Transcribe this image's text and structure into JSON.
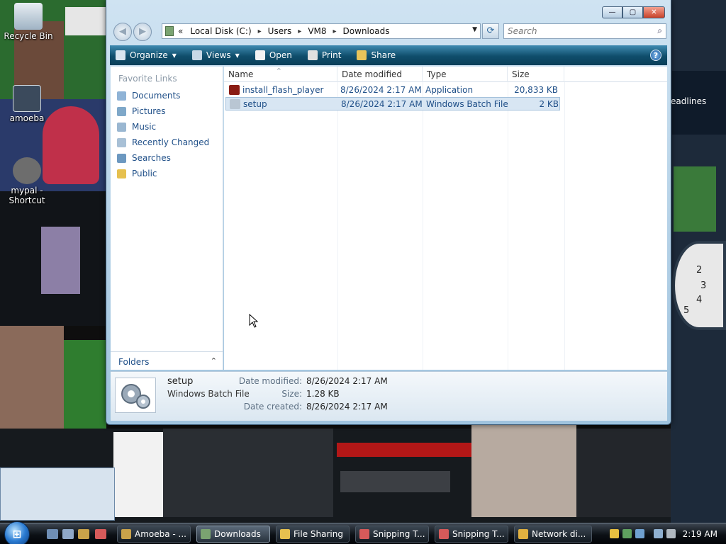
{
  "desktop": {
    "icons": [
      {
        "label": "Recycle Bin"
      },
      {
        "label": "amoeba"
      },
      {
        "label": "mypal - Shortcut"
      }
    ],
    "gadget_text": "eadlines",
    "clock_numbers": [
      "2",
      "3",
      "4",
      "5"
    ]
  },
  "window": {
    "caption": {
      "minimize": "—",
      "maximize": "▢",
      "close": "✕"
    },
    "nav": {
      "back": "◀",
      "forward": "▶"
    },
    "address": {
      "crumbs": [
        "Local Disk (C:)",
        "Users",
        "VM8",
        "Downloads"
      ],
      "separator": "▸",
      "lead": "«",
      "dropdown": "▼"
    },
    "refresh": "⟳",
    "search": {
      "placeholder": "Search",
      "icon": "⌕"
    },
    "commands": [
      {
        "label": "Organize",
        "icon": "organize-icon",
        "color": "#d9e6f0",
        "dropdown": true
      },
      {
        "label": "Views",
        "icon": "views-icon",
        "color": "#c7d7e6",
        "dropdown": true
      },
      {
        "label": "Open",
        "icon": "open-icon",
        "color": "#f3f3f3",
        "dropdown": false
      },
      {
        "label": "Print",
        "icon": "print-icon",
        "color": "#e0e0e0",
        "dropdown": false
      },
      {
        "label": "Share",
        "icon": "share-icon",
        "color": "#e8c45a",
        "dropdown": false
      }
    ],
    "help": "?",
    "favorite_links_title": "Favorite Links",
    "favorite_links": [
      {
        "label": "Documents",
        "color": "#8fb3d6"
      },
      {
        "label": "Pictures",
        "color": "#7fa8c9"
      },
      {
        "label": "Music",
        "color": "#9ab7d1"
      },
      {
        "label": "Recently Changed",
        "color": "#a8c0d6"
      },
      {
        "label": "Searches",
        "color": "#6c98c0"
      },
      {
        "label": "Public",
        "color": "#e6c04f"
      }
    ],
    "folders_label": "Folders",
    "folders_chevron": "⌃",
    "columns": [
      "Name",
      "Date modified",
      "Type",
      "Size"
    ],
    "sort_indicator": "^",
    "files": [
      {
        "name": "install_flash_player",
        "date": "8/26/2024 2:17 AM",
        "type": "Application",
        "size": "20,833 KB",
        "icon_color": "#8a1c14"
      },
      {
        "name": "setup",
        "date": "8/26/2024 2:17 AM",
        "type": "Windows Batch File",
        "size": "2 KB",
        "icon_color": "#b9c6d3"
      }
    ],
    "details": {
      "name": "setup",
      "type": "Windows Batch File",
      "date_modified_label": "Date modified:",
      "date_modified": "8/26/2024 2:17 AM",
      "size_label": "Size:",
      "size": "1.28 KB",
      "date_created_label": "Date created:",
      "date_created": "8/26/2024 2:17 AM"
    }
  },
  "taskbar": {
    "start": "⊞",
    "tasks": [
      {
        "label": "Amoeba - ...",
        "color": "#c9a24a",
        "active": false
      },
      {
        "label": "Downloads",
        "color": "#7aa371",
        "active": true
      },
      {
        "label": "File Sharing",
        "color": "#e6c04f",
        "active": false
      },
      {
        "label": "Snipping T...",
        "color": "#d65a5a",
        "active": false
      },
      {
        "label": "Snipping T...",
        "color": "#d65a5a",
        "active": false
      },
      {
        "label": "Network di...",
        "color": "#e0b040",
        "active": false
      }
    ],
    "clock": "2:19 AM"
  }
}
